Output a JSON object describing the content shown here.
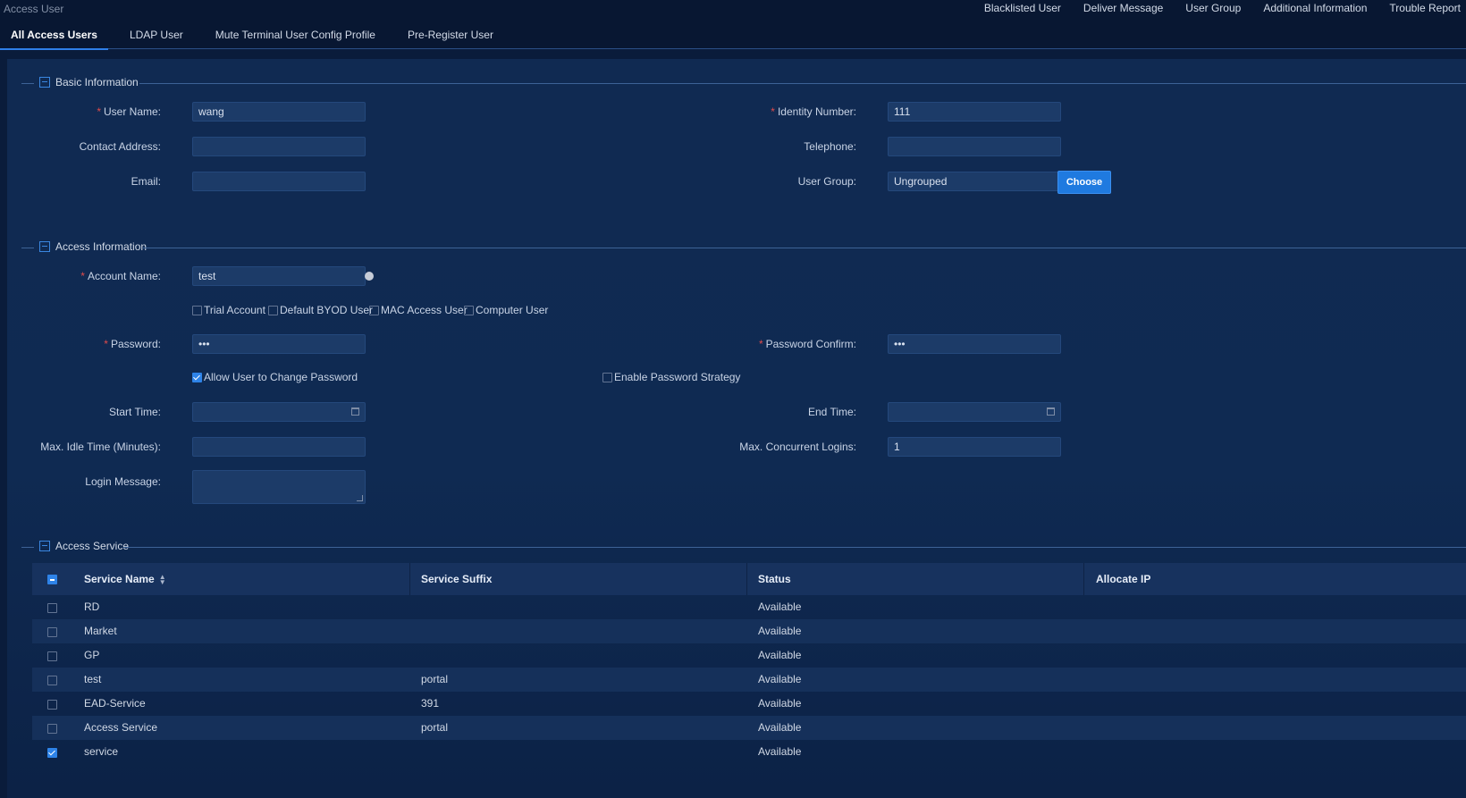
{
  "breadcrumb": "Access User",
  "top_nav": [
    "Blacklisted User",
    "Deliver Message",
    "User Group",
    "Additional Information",
    "Trouble Report"
  ],
  "tabs": [
    {
      "label": "All Access Users",
      "active": true
    },
    {
      "label": "LDAP User",
      "active": false
    },
    {
      "label": "Mute Terminal User Config Profile",
      "active": false
    },
    {
      "label": "Pre-Register User",
      "active": false
    }
  ],
  "basic": {
    "title": "Basic Information",
    "user_name_label": "User Name:",
    "user_name": "wang",
    "identity_label": "Identity Number:",
    "identity": "111",
    "contact_label": "Contact Address:",
    "contact": "",
    "telephone_label": "Telephone:",
    "telephone": "",
    "email_label": "Email:",
    "email": "",
    "group_label": "User Group:",
    "group": "Ungrouped",
    "choose_label": "Choose"
  },
  "access": {
    "title": "Access Information",
    "account_label": "Account Name:",
    "account": "test",
    "options": [
      {
        "label": "Trial Account",
        "checked": false
      },
      {
        "label": "Default BYOD User",
        "checked": false
      },
      {
        "label": "MAC Access User",
        "checked": false
      },
      {
        "label": "Computer User",
        "checked": false
      }
    ],
    "password_label": "Password:",
    "password": "•••",
    "password_confirm_label": "Password Confirm:",
    "password_confirm": "•••",
    "allow_change_label": "Allow User to Change Password",
    "allow_change_checked": true,
    "strategy_label": "Enable Password Strategy",
    "strategy_checked": false,
    "start_label": "Start Time:",
    "start": "",
    "end_label": "End Time:",
    "end": "",
    "idle_label": "Max. Idle Time (Minutes):",
    "idle": "",
    "concurrent_label": "Max. Concurrent Logins:",
    "concurrent": "1",
    "login_msg_label": "Login Message:",
    "login_msg": ""
  },
  "service": {
    "title": "Access Service",
    "columns": [
      "Service Name",
      "Service Suffix",
      "Status",
      "Allocate IP"
    ],
    "rows": [
      {
        "name": "RD",
        "suffix": "",
        "status": "Available",
        "ip": "",
        "checked": false
      },
      {
        "name": "Market",
        "suffix": "",
        "status": "Available",
        "ip": "",
        "checked": false
      },
      {
        "name": "GP",
        "suffix": "",
        "status": "Available",
        "ip": "",
        "checked": false
      },
      {
        "name": "test",
        "suffix": "portal",
        "status": "Available",
        "ip": "",
        "checked": false
      },
      {
        "name": "EAD-Service",
        "suffix": "391",
        "status": "Available",
        "ip": "",
        "checked": false
      },
      {
        "name": "Access Service",
        "suffix": "portal",
        "status": "Available",
        "ip": "",
        "checked": false
      },
      {
        "name": "service",
        "suffix": "",
        "status": "Available",
        "ip": "",
        "checked": true
      }
    ]
  },
  "icons": [
    "collapse-icon",
    "calendar-icon",
    "info-icon",
    "sort-icon",
    "checkbox-icon"
  ],
  "colors": {
    "accent": "#1f7ae0",
    "required": "#e04b4b",
    "background": "#0a1c3b"
  }
}
